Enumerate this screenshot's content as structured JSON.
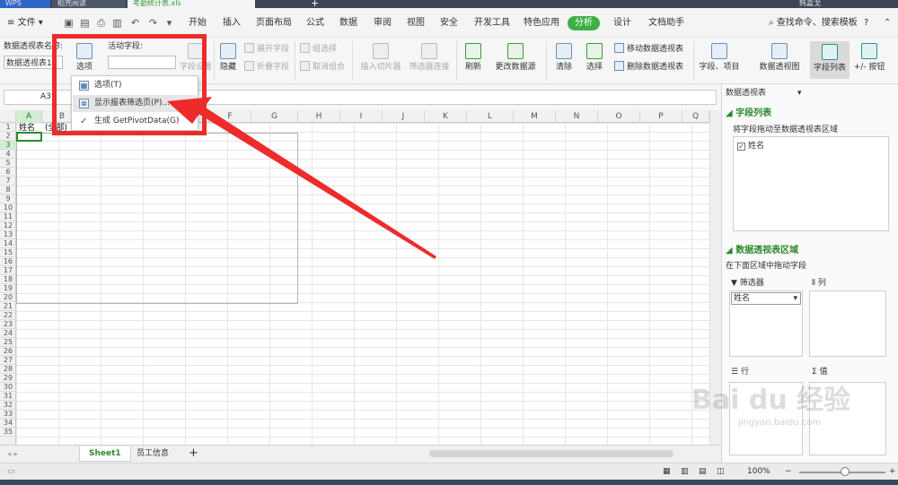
{
  "colors": {
    "accent": "#3cb043",
    "annotation": "#ee2b2b",
    "selection": "#2b8a2b"
  },
  "tabs": {
    "app": "WPS",
    "recent": "稻壳阅读",
    "file": "考勤统计表.xls",
    "add": "+",
    "user": "韩嘉戈"
  },
  "menu": {
    "file": "文件",
    "items": [
      "开始",
      "插入",
      "页面布局",
      "公式",
      "数据",
      "审阅",
      "视图",
      "安全",
      "开发工具",
      "特色应用",
      "分析",
      "设计",
      "文档助手"
    ],
    "active_index": 10,
    "search": "查找命令、搜索模板",
    "help": "?"
  },
  "ribbon": {
    "pivot_name_label": "数据透视表名称:",
    "pivot_name_value": "数据透视表1",
    "options": "选项",
    "active_field_label": "活动字段:",
    "field_settings": "字段设置",
    "hide": "隐藏",
    "expand_field": "展开字段",
    "collapse_field": "折叠字段",
    "group_select": "组选择",
    "ungroup": "取消组合",
    "insert_slicer": "插入切片器",
    "filter_connections": "筛选器连接",
    "refresh": "刷新",
    "change_source": "更改数据源",
    "clear": "清除",
    "select": "选择",
    "move_pivot": "移动数据透视表",
    "delete_pivot": "删除数据透视表",
    "fields_items": "字段、项目",
    "pivot_chart": "数据透视图",
    "field_list": "字段列表",
    "buttons": "+/- 按钮"
  },
  "formula": {
    "namebox": "A3",
    "fx": "fx"
  },
  "columns": [
    "A",
    "B",
    "C",
    "D",
    "E",
    "F",
    "G",
    "H",
    "I",
    "J",
    "K",
    "L",
    "M",
    "N",
    "O",
    "P",
    "Q"
  ],
  "rows": [
    "1",
    "2",
    "3",
    "4",
    "5",
    "6",
    "7",
    "8",
    "9",
    "10",
    "11",
    "12",
    "13",
    "14",
    "15",
    "16",
    "17",
    "18",
    "19",
    "20",
    "21",
    "22",
    "23",
    "24",
    "25",
    "26",
    "27",
    "28",
    "29",
    "30",
    "31",
    "32",
    "33",
    "34",
    "35"
  ],
  "cells": {
    "a1": "姓名",
    "b1": "(全部)"
  },
  "dropdown": {
    "items": [
      "选项(T)",
      "显示报表筛选页(P)...",
      "生成 GetPivotData(G)"
    ],
    "highlighted_index": 1
  },
  "sheets": {
    "tabs": [
      "Sheet1",
      "员工信息"
    ],
    "active_index": 0,
    "add": "+"
  },
  "status": {
    "zoom": "100%",
    "minus": "−",
    "plus": "+"
  },
  "pane": {
    "title": "数据透视表",
    "field_list_heading": "字段列表",
    "field_list_hint": "将字段拖动至数据透视表区域",
    "fields": [
      {
        "name": "姓名",
        "checked": true
      }
    ],
    "areas_heading": "数据透视表区域",
    "areas_hint": "在下面区域中拖动字段",
    "filter_label": "筛选器",
    "columns_label": "列",
    "rows_label": "行",
    "values_label": "值",
    "filter_field": "姓名"
  },
  "watermark": {
    "brand": "Bai du 经验",
    "url": "jingyan.baidu.com"
  }
}
